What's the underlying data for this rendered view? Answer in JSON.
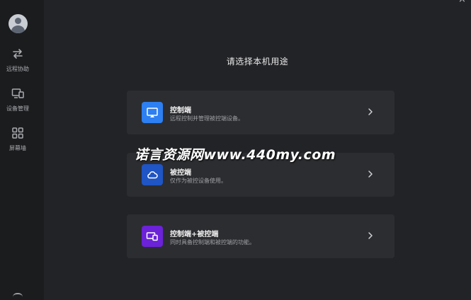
{
  "window": {
    "close_glyph": "×"
  },
  "sidebar": {
    "avatar_icon": "user-avatar-icon",
    "items": [
      {
        "label": "远程协助",
        "icon": "swap-arrows-icon"
      },
      {
        "label": "设备管理",
        "icon": "devices-icon"
      },
      {
        "label": "屏幕墙",
        "icon": "grid-icon"
      }
    ]
  },
  "main": {
    "title": "请选择本机用途",
    "cards": [
      {
        "title": "控制端",
        "desc": "远程控制并管理被控端设备。",
        "icon": "screen-cast-icon",
        "color": "#2d7ff2"
      },
      {
        "title": "被控端",
        "desc": "仅作为被控设备使用。",
        "icon": "cloud-icon",
        "color": "#1f55c4"
      },
      {
        "title": "控制端+被控端",
        "desc": "同时具备控制端和被控端的功能。",
        "icon": "dual-screen-icon",
        "color": "#6b22d8"
      }
    ]
  },
  "watermark": "诺言资源网www.440my.com",
  "colors": {
    "background": "#222326",
    "sidebar": "#1b1c1e",
    "card": "#2c2d30"
  }
}
